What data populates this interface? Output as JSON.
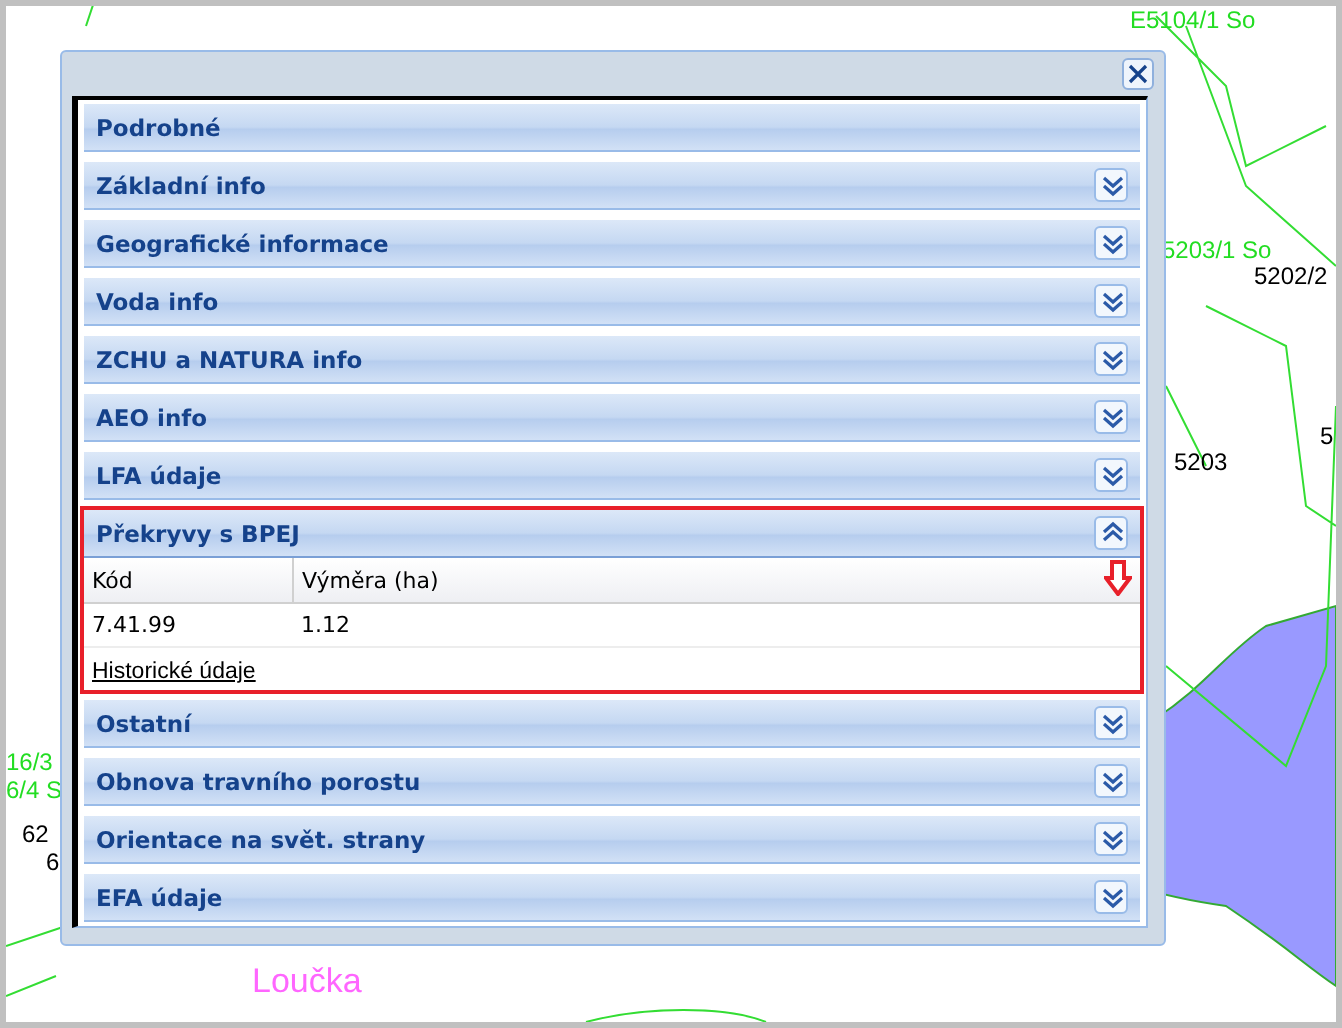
{
  "map": {
    "labels": [
      {
        "text": "E5104/1 So",
        "kind": "parcel"
      },
      {
        "text": "5203/1 So",
        "kind": "parcel"
      },
      {
        "text": "5202/2",
        "kind": "number"
      },
      {
        "text": "5203",
        "kind": "number"
      },
      {
        "text": "5",
        "kind": "number"
      },
      {
        "text": "16/3",
        "kind": "parcel"
      },
      {
        "text": "6/4 S",
        "kind": "parcel"
      },
      {
        "text": "62",
        "kind": "number"
      },
      {
        "text": "6",
        "kind": "number"
      },
      {
        "text": "Loučka",
        "kind": "place"
      }
    ]
  },
  "window": {
    "sections": [
      {
        "title": "Podrobné",
        "collapsible": false,
        "expanded": false,
        "highlighted": false
      },
      {
        "title": "Základní info",
        "collapsible": true,
        "expanded": false,
        "highlighted": false
      },
      {
        "title": "Geografické informace",
        "collapsible": true,
        "expanded": false,
        "highlighted": false
      },
      {
        "title": "Voda info",
        "collapsible": true,
        "expanded": false,
        "highlighted": false
      },
      {
        "title": "ZCHU a NATURA info",
        "collapsible": true,
        "expanded": false,
        "highlighted": false
      },
      {
        "title": "AEO info",
        "collapsible": true,
        "expanded": false,
        "highlighted": false
      },
      {
        "title": "LFA údaje",
        "collapsible": true,
        "expanded": false,
        "highlighted": false
      },
      {
        "title": "Překryvy s BPEJ",
        "collapsible": true,
        "expanded": true,
        "highlighted": true,
        "table": {
          "columns": [
            "Kód",
            "Výměra (ha)"
          ],
          "rows": [
            [
              "7.41.99",
              "1.12"
            ]
          ]
        },
        "link": "Historické údaje"
      },
      {
        "title": "Ostatní",
        "collapsible": true,
        "expanded": false,
        "highlighted": false
      },
      {
        "title": "Obnova travního porostu",
        "collapsible": true,
        "expanded": false,
        "highlighted": false
      },
      {
        "title": "Orientace na svět. strany",
        "collapsible": true,
        "expanded": false,
        "highlighted": false
      },
      {
        "title": "EFA údaje",
        "collapsible": true,
        "expanded": false,
        "highlighted": false
      }
    ]
  }
}
